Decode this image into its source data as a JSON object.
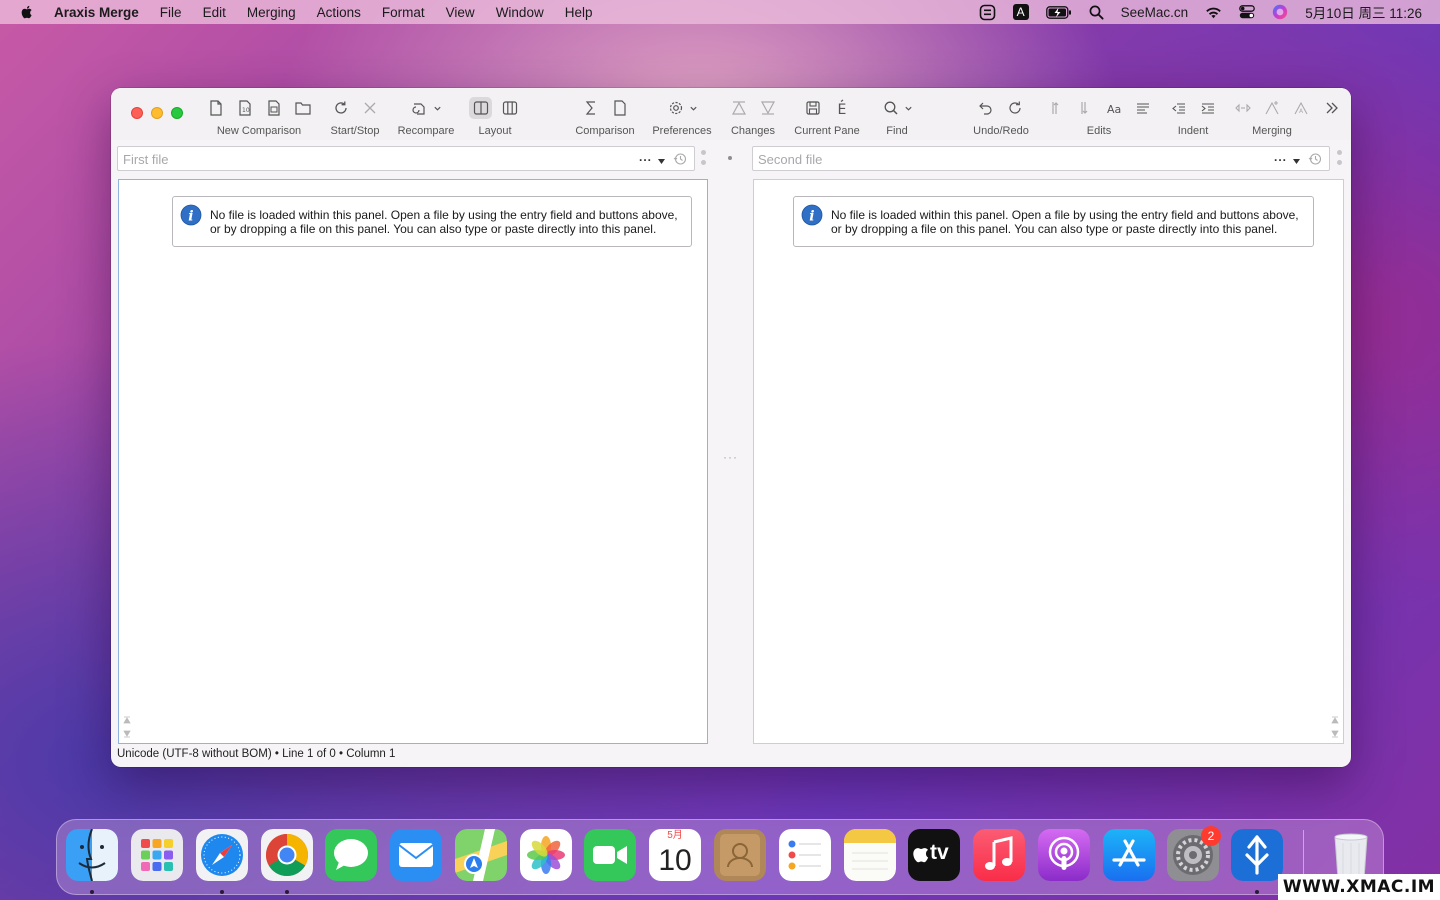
{
  "menubar": {
    "app_name": "Araxis Merge",
    "items": [
      "File",
      "Edit",
      "Merging",
      "Actions",
      "Format",
      "View",
      "Window",
      "Help"
    ],
    "status": {
      "input_source": "A",
      "site": "SeeMac.cn",
      "clock": "5月10日 周三  11:26"
    }
  },
  "toolbar": {
    "groups": [
      {
        "label": "New Comparison"
      },
      {
        "label": "Start/Stop"
      },
      {
        "label": "Recompare"
      },
      {
        "label": "Layout"
      },
      {
        "label": "Comparison"
      },
      {
        "label": "Preferences"
      },
      {
        "label": "Changes"
      },
      {
        "label": "Current Pane"
      },
      {
        "label": "Find"
      },
      {
        "label": "Undo/Redo"
      },
      {
        "label": "Edits"
      },
      {
        "label": "Indent"
      },
      {
        "label": "Merging"
      }
    ]
  },
  "left_panel": {
    "placeholder": "First file",
    "dots": "...",
    "notice": "No file is loaded within this panel. Open a file by using the entry field and buttons above, or by dropping a file on this panel. You can also type or paste directly into this panel."
  },
  "right_panel": {
    "placeholder": "Second file",
    "dots": "...",
    "notice": "No file is loaded within this panel. Open a file by using the entry field and buttons above, or by dropping a file on this panel. You can also type or paste directly into this panel."
  },
  "splitter": {
    "dots": "···"
  },
  "statusbar": {
    "text": "Unicode (UTF-8 without BOM) • Line 1 of 0 • Column 1"
  },
  "dock": {
    "calendar_month": "5月",
    "calendar_day": "10",
    "tv_label": "tv",
    "settings_badge": "2"
  },
  "watermark": "WWW.XMAC.IM",
  "colors": {
    "active_border": "#8fb4df",
    "info_blue": "#2f6fc6",
    "traffic_close": "#fe5f57",
    "traffic_min": "#febc2e",
    "traffic_max": "#28c840"
  }
}
